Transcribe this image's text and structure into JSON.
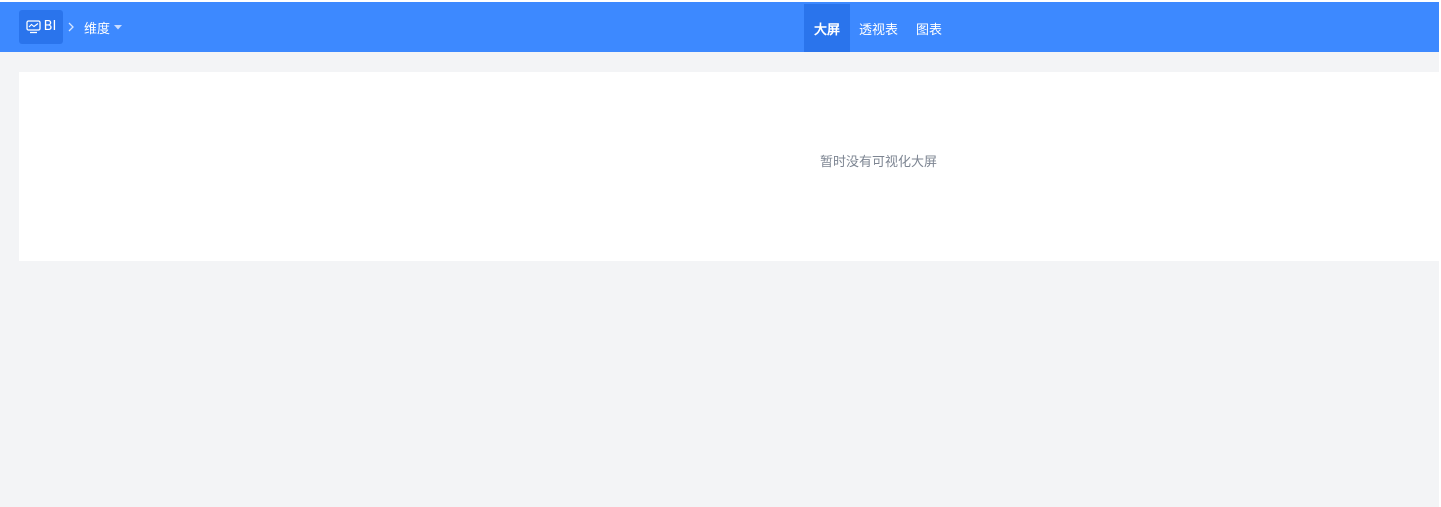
{
  "header": {
    "brand": {
      "label": "BI",
      "icon": "monitor-icon"
    },
    "breadcrumb": {
      "label": "维度",
      "separator_icon": "chevron-right-icon",
      "dropdown_icon": "caret-down-icon"
    },
    "tabs": [
      {
        "label": "大屏",
        "active": true
      },
      {
        "label": "透视表",
        "active": false
      },
      {
        "label": "图表",
        "active": false
      }
    ]
  },
  "main": {
    "empty_text": "暂时没有可视化大屏"
  },
  "colors": {
    "header_bg": "#3d89ff",
    "header_active": "#2a74ec",
    "page_bg": "#f3f4f6",
    "panel_bg": "#ffffff",
    "muted_text": "#7d8592"
  }
}
